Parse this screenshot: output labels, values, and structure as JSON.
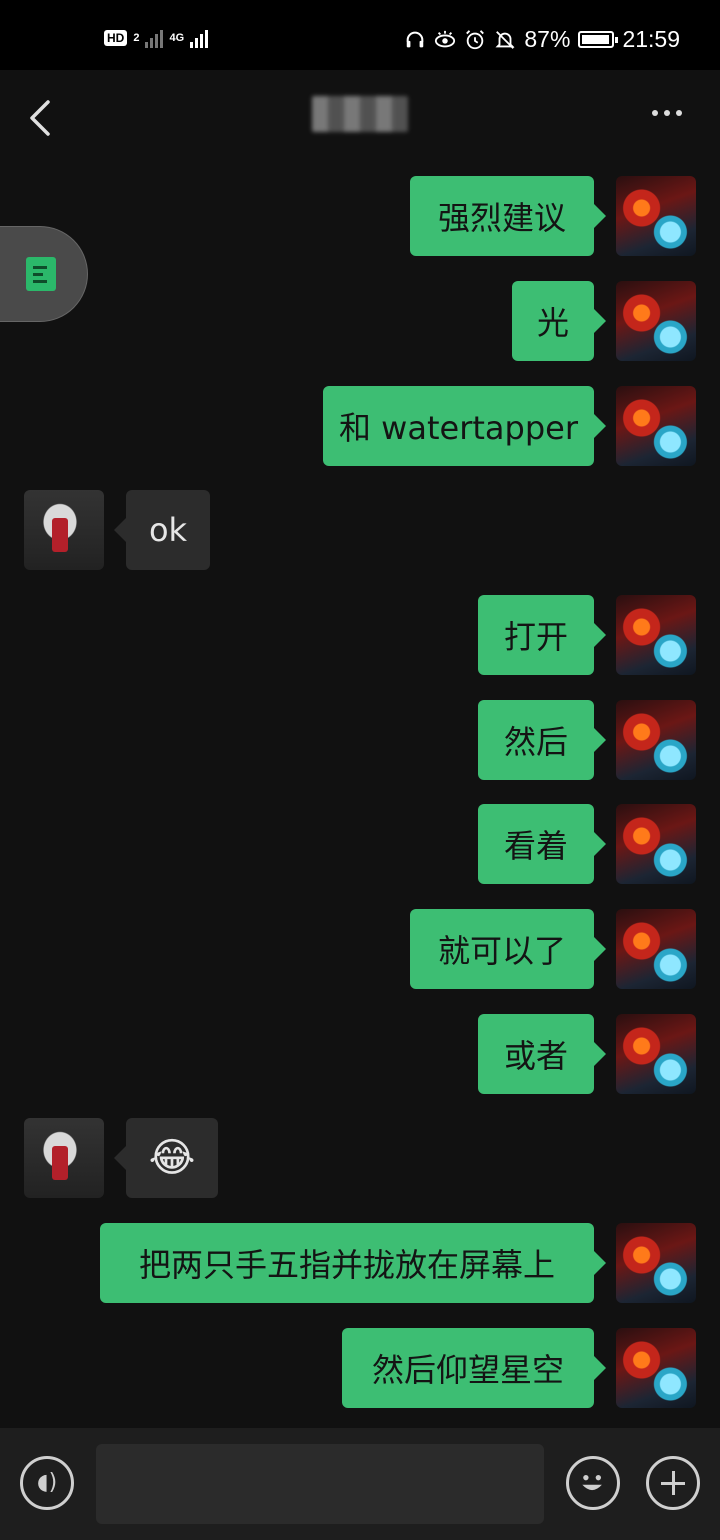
{
  "status_bar": {
    "hd_label": "HD",
    "sim_label": "2",
    "network_label": "4G",
    "battery_percent": "87%",
    "time": "21:59"
  },
  "header": {
    "back_icon": "back-chevron-icon",
    "more_icon": "more-dots-icon"
  },
  "messages": [
    {
      "sender": "me",
      "text": "强烈建议"
    },
    {
      "sender": "me",
      "text": "光"
    },
    {
      "sender": "me",
      "text": "和 watertapper"
    },
    {
      "sender": "them",
      "text": "ok"
    },
    {
      "sender": "me",
      "text": "打开"
    },
    {
      "sender": "me",
      "text": "然后"
    },
    {
      "sender": "me",
      "text": "看着"
    },
    {
      "sender": "me",
      "text": "就可以了"
    },
    {
      "sender": "me",
      "text": "或者"
    },
    {
      "sender": "them",
      "text": "😂"
    },
    {
      "sender": "me",
      "text": "把两只手五指并拢放在屏幕上"
    },
    {
      "sender": "me",
      "text": "然后仰望星空"
    }
  ],
  "input_bar": {
    "voice_icon": "voice-icon",
    "message_value": "",
    "emoji_icon": "emoji-icon",
    "plus_icon": "plus-icon"
  },
  "colors": {
    "background": "#111111",
    "my_bubble": "#3dbe73",
    "their_bubble": "#2c2c2c"
  }
}
